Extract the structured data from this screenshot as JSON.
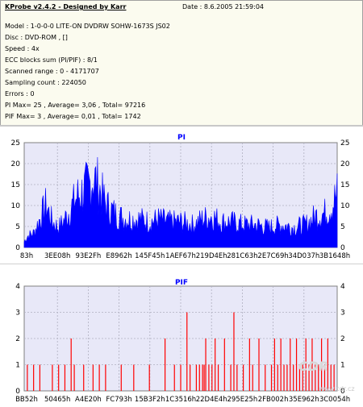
{
  "info": {
    "title": "KProbe v2.4.2 - Designed by Karr",
    "date": "Date : 8.6.2005 21:59:04",
    "lines": [
      "Model : 1-0-0-0 LITE-ON DVDRW SOHW-1673S JS02",
      "Disc : DVD-ROM ,  []",
      "Speed : 4x",
      "ECC blocks sum (PI/PIF) : 8/1",
      "Scanned range : 0 - 4171707",
      "Sampling count : 224050",
      "Errors : 0",
      "PI Max= 25 , Average= 3,06 , Total= 97216",
      "PIF Max= 3 , Average= 0,01 , Total= 1742"
    ]
  },
  "watermark": {
    "logo": "CDR",
    "url": "www.cdr.cz"
  },
  "colors": {
    "pi": "#0000ff",
    "pif": "#ff0000",
    "plot_bg": "#e8e8f8",
    "grid": "#b0b0c0"
  },
  "chart_data": [
    {
      "type": "area",
      "title": "PI",
      "ylim": [
        0,
        25
      ],
      "yticks": [
        0,
        5,
        10,
        15,
        20,
        25
      ],
      "xtick_labels": [
        "83h",
        "3EE08h",
        "93E2Fh",
        "E8962h",
        "145F45h",
        "1AEF67h",
        "219D4Eh",
        "281C63h",
        "2E7C69h",
        "34D037h",
        "3B1648h"
      ],
      "grid": true,
      "envelope": [
        [
          0.0,
          2
        ],
        [
          0.01,
          4
        ],
        [
          0.03,
          5
        ],
        [
          0.05,
          10
        ],
        [
          0.07,
          15
        ],
        [
          0.09,
          9
        ],
        [
          0.11,
          7
        ],
        [
          0.13,
          10
        ],
        [
          0.15,
          14
        ],
        [
          0.17,
          18
        ],
        [
          0.19,
          20
        ],
        [
          0.21,
          22
        ],
        [
          0.22,
          25
        ],
        [
          0.24,
          21
        ],
        [
          0.26,
          15
        ],
        [
          0.28,
          13
        ],
        [
          0.3,
          11
        ],
        [
          0.33,
          10
        ],
        [
          0.37,
          10
        ],
        [
          0.4,
          9
        ],
        [
          0.43,
          10
        ],
        [
          0.46,
          9
        ],
        [
          0.5,
          9
        ],
        [
          0.54,
          8
        ],
        [
          0.57,
          10
        ],
        [
          0.6,
          11
        ],
        [
          0.63,
          9
        ],
        [
          0.66,
          9
        ],
        [
          0.7,
          8
        ],
        [
          0.74,
          8
        ],
        [
          0.78,
          7
        ],
        [
          0.82,
          8
        ],
        [
          0.86,
          7
        ],
        [
          0.9,
          8
        ],
        [
          0.93,
          11
        ],
        [
          0.96,
          12
        ],
        [
          0.985,
          15
        ],
        [
          1.0,
          19
        ]
      ]
    },
    {
      "type": "bar",
      "title": "PIF",
      "ylim": [
        0,
        4
      ],
      "yticks": [
        0,
        1,
        2,
        3,
        4
      ],
      "xtick_labels": [
        "BB52h",
        "50465h",
        "A4E20h",
        "FC793h",
        "15B3F2h",
        "1C3516h",
        "22D4E4h",
        "295E25h",
        "2FB002h",
        "35E962h",
        "3C0054h"
      ],
      "grid": true,
      "spikes": [
        [
          0.01,
          1
        ],
        [
          0.03,
          1
        ],
        [
          0.05,
          1
        ],
        [
          0.09,
          1
        ],
        [
          0.11,
          1
        ],
        [
          0.13,
          1
        ],
        [
          0.15,
          2
        ],
        [
          0.16,
          1
        ],
        [
          0.19,
          1
        ],
        [
          0.22,
          1
        ],
        [
          0.24,
          1
        ],
        [
          0.26,
          1
        ],
        [
          0.31,
          1
        ],
        [
          0.35,
          1
        ],
        [
          0.4,
          1
        ],
        [
          0.45,
          2
        ],
        [
          0.48,
          1
        ],
        [
          0.5,
          1
        ],
        [
          0.52,
          3
        ],
        [
          0.53,
          1
        ],
        [
          0.55,
          1
        ],
        [
          0.56,
          1
        ],
        [
          0.57,
          1
        ],
        [
          0.575,
          1
        ],
        [
          0.58,
          2
        ],
        [
          0.59,
          1
        ],
        [
          0.6,
          1
        ],
        [
          0.61,
          2
        ],
        [
          0.62,
          1
        ],
        [
          0.64,
          2
        ],
        [
          0.66,
          1
        ],
        [
          0.67,
          3
        ],
        [
          0.68,
          1
        ],
        [
          0.7,
          1
        ],
        [
          0.72,
          2
        ],
        [
          0.73,
          1
        ],
        [
          0.75,
          2
        ],
        [
          0.77,
          1
        ],
        [
          0.79,
          1
        ],
        [
          0.8,
          2
        ],
        [
          0.81,
          1
        ],
        [
          0.82,
          2
        ],
        [
          0.83,
          1
        ],
        [
          0.84,
          1
        ],
        [
          0.85,
          2
        ],
        [
          0.86,
          1
        ],
        [
          0.87,
          2
        ],
        [
          0.88,
          1
        ],
        [
          0.89,
          1
        ],
        [
          0.9,
          2
        ],
        [
          0.91,
          1
        ],
        [
          0.92,
          2
        ],
        [
          0.93,
          1
        ],
        [
          0.94,
          1
        ],
        [
          0.95,
          2
        ],
        [
          0.96,
          1
        ],
        [
          0.97,
          2
        ],
        [
          0.98,
          1
        ],
        [
          0.99,
          1
        ]
      ]
    }
  ]
}
